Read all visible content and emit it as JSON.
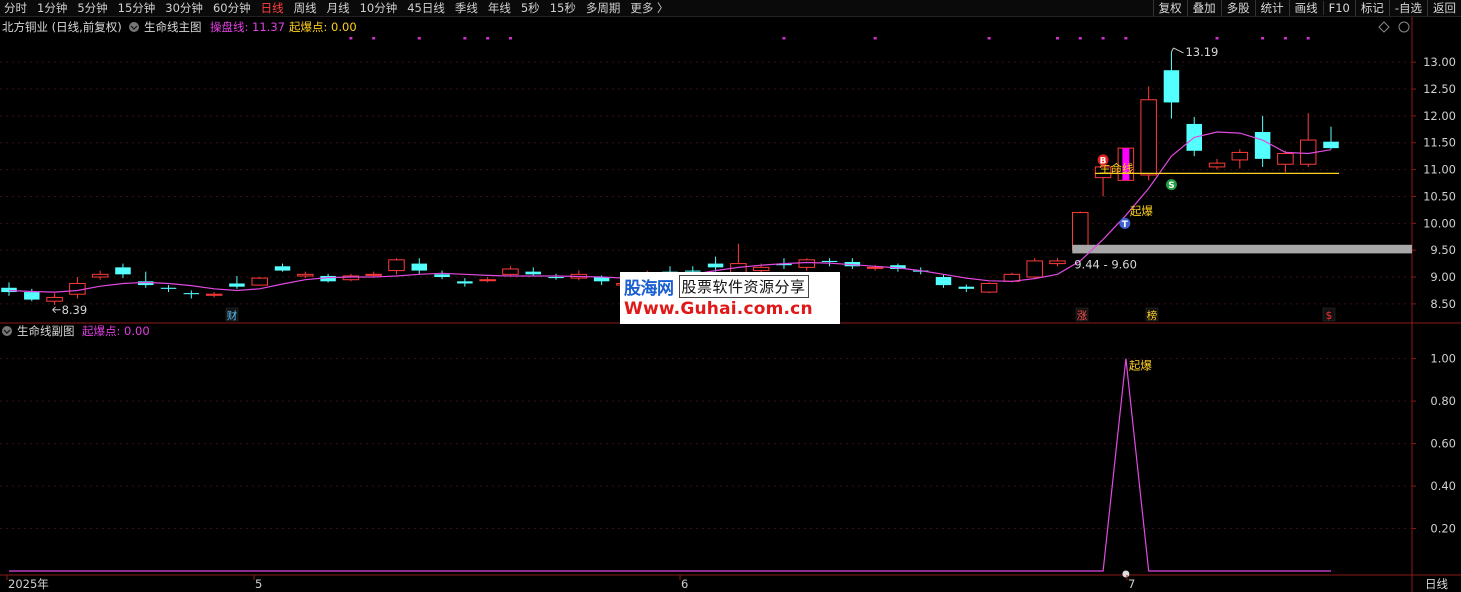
{
  "toolbar": {
    "periods": [
      "分时",
      "1分钟",
      "5分钟",
      "15分钟",
      "30分钟",
      "60分钟",
      "日线",
      "周线",
      "月线",
      "10分钟",
      "45日线",
      "季线",
      "年线",
      "5秒",
      "15秒",
      "多周期",
      "更多 〉"
    ],
    "active_period": "日线",
    "right_buttons": [
      "复权",
      "叠加",
      "多股",
      "统计",
      "画线",
      "F10",
      "标记",
      "-自选",
      "返回"
    ]
  },
  "main_panel": {
    "stock_title": "北方铜业 (日线,前复权)",
    "indicator_name": "生命线主图",
    "line1_label": "操盘线: 11.37",
    "line2_label": "起爆点: 0.00",
    "high_label": "13.19",
    "low_label": "8.39",
    "range_label": "9.44 - 9.60",
    "life_line_text": "生命线",
    "qibao_text": "起爆",
    "marker_b": "B",
    "marker_s": "S",
    "marker_t": "T",
    "event_cai": "财",
    "event_zhang": "涨",
    "event_bang": "榜",
    "event_s": "$",
    "icons": [
      "diamond-icon",
      "settings-icon"
    ]
  },
  "sub_panel": {
    "indicator_name": "生命线副图",
    "value_label": "起爆点: 0.00",
    "peak_label": "起爆"
  },
  "x_axis": {
    "labels": [
      "2025年",
      "5",
      "6",
      "7"
    ],
    "period_label": "日线"
  },
  "watermark": {
    "logo": "股海网",
    "slogan": "股票软件资源分享",
    "url": "Www.Guhai.com.cn"
  },
  "colors": {
    "up": "#ff3b3b",
    "down": "#54ffff",
    "ma_line": "#e04ae0",
    "yellow": "#ffd020",
    "pink_dot": "#d030d0"
  },
  "chart_data": [
    {
      "type": "candlestick",
      "title": "生命线主图",
      "y_ticks": [
        8.5,
        9.0,
        9.5,
        10.0,
        10.5,
        11.0,
        11.5,
        12.0,
        12.5,
        13.0
      ],
      "ylim": [
        8.2,
        13.45
      ],
      "candles": [
        [
          8.8,
          8.72,
          8.9,
          8.65
        ],
        [
          8.72,
          8.58,
          8.78,
          8.55
        ],
        [
          8.55,
          8.62,
          8.7,
          8.48
        ],
        [
          8.68,
          8.88,
          9.0,
          8.6
        ],
        [
          9.0,
          9.05,
          9.12,
          8.95
        ],
        [
          9.18,
          9.05,
          9.25,
          8.98
        ],
        [
          8.92,
          8.85,
          9.1,
          8.8
        ],
        [
          8.8,
          8.78,
          8.85,
          8.72
        ],
        [
          8.7,
          8.68,
          8.75,
          8.6
        ],
        [
          8.66,
          8.68,
          8.72,
          8.62
        ],
        [
          8.88,
          8.82,
          9.02,
          8.78
        ],
        [
          8.85,
          8.98,
          9.0,
          8.84
        ],
        [
          9.2,
          9.12,
          9.25,
          9.1
        ],
        [
          9.02,
          9.05,
          9.1,
          8.98
        ],
        [
          9.02,
          8.92,
          9.06,
          8.9
        ],
        [
          8.95,
          9.02,
          9.06,
          8.92
        ],
        [
          9.05,
          9.05,
          9.1,
          9.0
        ],
        [
          9.12,
          9.32,
          9.35,
          9.05
        ],
        [
          9.25,
          9.12,
          9.35,
          9.05
        ],
        [
          9.05,
          9.0,
          9.12,
          8.96
        ],
        [
          8.92,
          8.88,
          8.98,
          8.82
        ],
        [
          8.95,
          8.95,
          9.0,
          8.9
        ],
        [
          9.05,
          9.15,
          9.2,
          9.02
        ],
        [
          9.1,
          9.05,
          9.18,
          9.02
        ],
        [
          9.0,
          8.98,
          9.06,
          8.95
        ],
        [
          8.98,
          9.05,
          9.12,
          8.94
        ],
        [
          9.0,
          8.92,
          9.03,
          8.85
        ],
        [
          8.85,
          8.88,
          8.9,
          8.82
        ],
        [
          9.08,
          9.08,
          9.12,
          9.0
        ],
        [
          9.1,
          9.05,
          9.2,
          9.0
        ],
        [
          9.12,
          9.1,
          9.2,
          9.05
        ],
        [
          9.25,
          9.18,
          9.38,
          9.1
        ],
        [
          9.05,
          9.25,
          9.62,
          9.0
        ],
        [
          9.12,
          9.18,
          9.25,
          9.05
        ],
        [
          9.25,
          9.22,
          9.35,
          9.15
        ],
        [
          9.18,
          9.32,
          9.35,
          9.12
        ],
        [
          9.3,
          9.28,
          9.35,
          9.2
        ],
        [
          9.28,
          9.2,
          9.35,
          9.15
        ],
        [
          9.18,
          9.18,
          9.22,
          9.12
        ],
        [
          9.22,
          9.15,
          9.25,
          9.1
        ],
        [
          9.12,
          9.1,
          9.18,
          9.05
        ],
        [
          9.0,
          8.85,
          9.05,
          8.8
        ],
        [
          8.82,
          8.78,
          8.86,
          8.72
        ],
        [
          8.72,
          8.88,
          8.9,
          8.7
        ],
        [
          8.92,
          9.05,
          9.08,
          8.9
        ],
        [
          9.0,
          9.3,
          9.35,
          8.98
        ],
        [
          9.25,
          9.3,
          9.35,
          9.2
        ],
        [
          9.5,
          10.2,
          10.22,
          9.45
        ],
        [
          10.85,
          11.05,
          11.15,
          10.5
        ],
        [
          10.8,
          11.4,
          11.4,
          10.8
        ],
        [
          10.9,
          12.3,
          12.55,
          10.8
        ],
        [
          12.85,
          12.25,
          13.19,
          11.95
        ],
        [
          11.85,
          11.35,
          11.98,
          11.25
        ],
        [
          11.05,
          11.12,
          11.2,
          11.0
        ],
        [
          11.18,
          11.32,
          11.38,
          11.02
        ],
        [
          11.7,
          11.2,
          12.0,
          11.05
        ],
        [
          11.1,
          11.3,
          11.35,
          10.95
        ],
        [
          11.1,
          11.55,
          12.05,
          11.05
        ],
        [
          11.52,
          11.4,
          11.8,
          11.38
        ]
      ],
      "ma_series": [
        8.75,
        8.73,
        8.72,
        8.75,
        8.83,
        8.88,
        8.9,
        8.88,
        8.84,
        8.78,
        8.75,
        8.78,
        8.87,
        8.95,
        8.99,
        9.0,
        9.0,
        9.02,
        9.05,
        9.07,
        9.05,
        9.03,
        9.02,
        9.02,
        9.02,
        9.01,
        9.0,
        8.98,
        8.97,
        9.0,
        9.05,
        9.12,
        9.18,
        9.22,
        9.25,
        9.27,
        9.26,
        9.23,
        9.2,
        9.17,
        9.12,
        9.05,
        8.98,
        8.93,
        8.92,
        8.97,
        9.05,
        9.3,
        9.7,
        10.15,
        10.65,
        11.25,
        11.6,
        11.7,
        11.68,
        11.55,
        11.32,
        11.3,
        11.37
      ],
      "last_ma_value": 11.37,
      "support_band": [
        9.44,
        9.6
      ],
      "life_line_level": 10.93
    },
    {
      "type": "line",
      "title": "生命线副图",
      "y_ticks": [
        0.2,
        0.4,
        0.6,
        0.8,
        1.0
      ],
      "ylim": [
        0,
        1.05
      ],
      "values": [
        0,
        0,
        0,
        0,
        0,
        0,
        0,
        0,
        0,
        0,
        0,
        0,
        0,
        0,
        0,
        0,
        0,
        0,
        0,
        0,
        0,
        0,
        0,
        0,
        0,
        0,
        0,
        0,
        0,
        0,
        0,
        0,
        0,
        0,
        0,
        0,
        0,
        0,
        0,
        0,
        0,
        0,
        0,
        0,
        0,
        0,
        0,
        0,
        0,
        1,
        0,
        0,
        0,
        0,
        0,
        0,
        0,
        0,
        0
      ]
    }
  ]
}
